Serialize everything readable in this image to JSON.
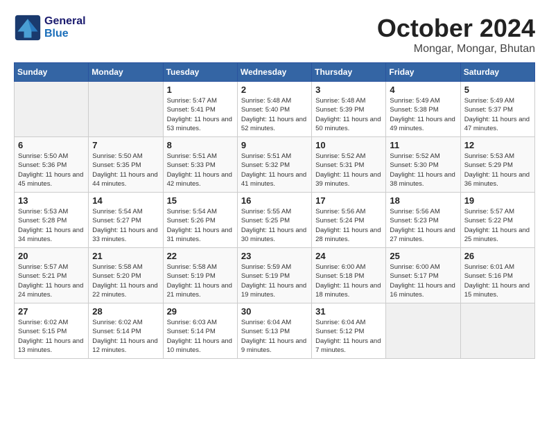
{
  "header": {
    "logo_general": "General",
    "logo_blue": "Blue",
    "month": "October 2024",
    "location": "Mongar, Mongar, Bhutan"
  },
  "days_of_week": [
    "Sunday",
    "Monday",
    "Tuesday",
    "Wednesday",
    "Thursday",
    "Friday",
    "Saturday"
  ],
  "weeks": [
    [
      {
        "day": "",
        "info": ""
      },
      {
        "day": "",
        "info": ""
      },
      {
        "day": "1",
        "info": "Sunrise: 5:47 AM\nSunset: 5:41 PM\nDaylight: 11 hours and 53 minutes."
      },
      {
        "day": "2",
        "info": "Sunrise: 5:48 AM\nSunset: 5:40 PM\nDaylight: 11 hours and 52 minutes."
      },
      {
        "day": "3",
        "info": "Sunrise: 5:48 AM\nSunset: 5:39 PM\nDaylight: 11 hours and 50 minutes."
      },
      {
        "day": "4",
        "info": "Sunrise: 5:49 AM\nSunset: 5:38 PM\nDaylight: 11 hours and 49 minutes."
      },
      {
        "day": "5",
        "info": "Sunrise: 5:49 AM\nSunset: 5:37 PM\nDaylight: 11 hours and 47 minutes."
      }
    ],
    [
      {
        "day": "6",
        "info": "Sunrise: 5:50 AM\nSunset: 5:36 PM\nDaylight: 11 hours and 45 minutes."
      },
      {
        "day": "7",
        "info": "Sunrise: 5:50 AM\nSunset: 5:35 PM\nDaylight: 11 hours and 44 minutes."
      },
      {
        "day": "8",
        "info": "Sunrise: 5:51 AM\nSunset: 5:33 PM\nDaylight: 11 hours and 42 minutes."
      },
      {
        "day": "9",
        "info": "Sunrise: 5:51 AM\nSunset: 5:32 PM\nDaylight: 11 hours and 41 minutes."
      },
      {
        "day": "10",
        "info": "Sunrise: 5:52 AM\nSunset: 5:31 PM\nDaylight: 11 hours and 39 minutes."
      },
      {
        "day": "11",
        "info": "Sunrise: 5:52 AM\nSunset: 5:30 PM\nDaylight: 11 hours and 38 minutes."
      },
      {
        "day": "12",
        "info": "Sunrise: 5:53 AM\nSunset: 5:29 PM\nDaylight: 11 hours and 36 minutes."
      }
    ],
    [
      {
        "day": "13",
        "info": "Sunrise: 5:53 AM\nSunset: 5:28 PM\nDaylight: 11 hours and 34 minutes."
      },
      {
        "day": "14",
        "info": "Sunrise: 5:54 AM\nSunset: 5:27 PM\nDaylight: 11 hours and 33 minutes."
      },
      {
        "day": "15",
        "info": "Sunrise: 5:54 AM\nSunset: 5:26 PM\nDaylight: 11 hours and 31 minutes."
      },
      {
        "day": "16",
        "info": "Sunrise: 5:55 AM\nSunset: 5:25 PM\nDaylight: 11 hours and 30 minutes."
      },
      {
        "day": "17",
        "info": "Sunrise: 5:56 AM\nSunset: 5:24 PM\nDaylight: 11 hours and 28 minutes."
      },
      {
        "day": "18",
        "info": "Sunrise: 5:56 AM\nSunset: 5:23 PM\nDaylight: 11 hours and 27 minutes."
      },
      {
        "day": "19",
        "info": "Sunrise: 5:57 AM\nSunset: 5:22 PM\nDaylight: 11 hours and 25 minutes."
      }
    ],
    [
      {
        "day": "20",
        "info": "Sunrise: 5:57 AM\nSunset: 5:21 PM\nDaylight: 11 hours and 24 minutes."
      },
      {
        "day": "21",
        "info": "Sunrise: 5:58 AM\nSunset: 5:20 PM\nDaylight: 11 hours and 22 minutes."
      },
      {
        "day": "22",
        "info": "Sunrise: 5:58 AM\nSunset: 5:19 PM\nDaylight: 11 hours and 21 minutes."
      },
      {
        "day": "23",
        "info": "Sunrise: 5:59 AM\nSunset: 5:19 PM\nDaylight: 11 hours and 19 minutes."
      },
      {
        "day": "24",
        "info": "Sunrise: 6:00 AM\nSunset: 5:18 PM\nDaylight: 11 hours and 18 minutes."
      },
      {
        "day": "25",
        "info": "Sunrise: 6:00 AM\nSunset: 5:17 PM\nDaylight: 11 hours and 16 minutes."
      },
      {
        "day": "26",
        "info": "Sunrise: 6:01 AM\nSunset: 5:16 PM\nDaylight: 11 hours and 15 minutes."
      }
    ],
    [
      {
        "day": "27",
        "info": "Sunrise: 6:02 AM\nSunset: 5:15 PM\nDaylight: 11 hours and 13 minutes."
      },
      {
        "day": "28",
        "info": "Sunrise: 6:02 AM\nSunset: 5:14 PM\nDaylight: 11 hours and 12 minutes."
      },
      {
        "day": "29",
        "info": "Sunrise: 6:03 AM\nSunset: 5:14 PM\nDaylight: 11 hours and 10 minutes."
      },
      {
        "day": "30",
        "info": "Sunrise: 6:04 AM\nSunset: 5:13 PM\nDaylight: 11 hours and 9 minutes."
      },
      {
        "day": "31",
        "info": "Sunrise: 6:04 AM\nSunset: 5:12 PM\nDaylight: 11 hours and 7 minutes."
      },
      {
        "day": "",
        "info": ""
      },
      {
        "day": "",
        "info": ""
      }
    ]
  ]
}
